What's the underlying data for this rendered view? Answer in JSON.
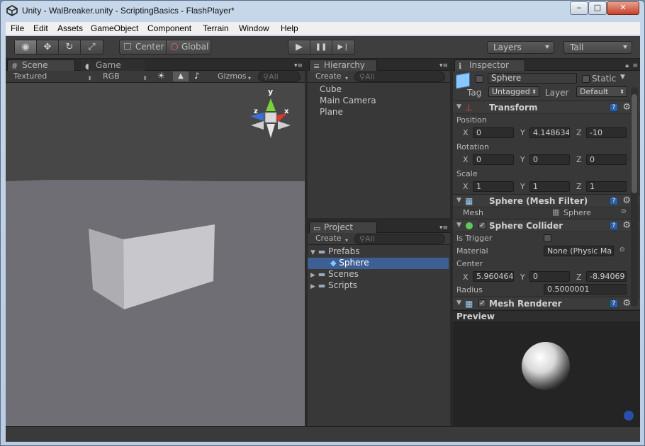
{
  "window": {
    "title": "Unity - WalBreaker.unity - ScriptingBasics - FlashPlayer*",
    "controls": {
      "minimize": "‒",
      "maximize": "□",
      "close": "✕"
    }
  },
  "menu": [
    "File",
    "Edit",
    "Assets",
    "GameObject",
    "Component",
    "Terrain",
    "Window",
    "Help"
  ],
  "toolbar": {
    "tools": [
      {
        "icon": "eye-icon",
        "glyph": "◉",
        "active": true
      },
      {
        "icon": "move-icon",
        "glyph": "✥",
        "active": false
      },
      {
        "icon": "rotate-icon",
        "glyph": "↻",
        "active": false
      },
      {
        "icon": "scale-icon",
        "glyph": "⤢",
        "active": false
      }
    ],
    "pivot_label": "Center",
    "space_label": "Global",
    "play_glyph": "▶",
    "pause_glyph": "❚❚",
    "step_glyph": "▶❘",
    "layers_label": "Layers",
    "layout_label": "Tall"
  },
  "scene": {
    "tabs": [
      {
        "label": "Scene",
        "icon": "scene-grid-icon",
        "glyph": "#"
      },
      {
        "label": "Game",
        "icon": "game-pacman-icon",
        "glyph": "◖"
      }
    ],
    "render_mode": "Textured",
    "color_mode": "RGB",
    "gizmos_label": "Gizmos",
    "search_placeholder": "All",
    "gizmo_y_label": "y",
    "gizmo_z_label": "z",
    "gizmo_x_label": "x",
    "colors": {
      "sky": "#474747",
      "ground": "#6e6e74",
      "cube_side": "#aeaeb2",
      "cube_front": "#c8c8cc"
    }
  },
  "hierarchy": {
    "tab": "Hierarchy",
    "create_label": "Create",
    "search_placeholder": "All",
    "items": [
      "Cube",
      "Main Camera",
      "Plane"
    ]
  },
  "project": {
    "tab": "Project",
    "create_label": "Create",
    "search_placeholder": "All",
    "folders": [
      {
        "label": "Prefabs",
        "expanded": true,
        "children": [
          {
            "label": "Sphere",
            "selected": true
          }
        ]
      },
      {
        "label": "Scenes",
        "expanded": false
      },
      {
        "label": "Scripts",
        "expanded": false
      }
    ]
  },
  "inspector": {
    "tab": "Inspector",
    "object_name": "Sphere",
    "static_label": "Static",
    "tag_label": "Tag",
    "tag_value": "Untagged",
    "layer_label": "Layer",
    "layer_value": "Default",
    "transform": {
      "title": "Transform",
      "position_label": "Position",
      "rotation_label": "Rotation",
      "scale_label": "Scale",
      "position": {
        "x": "0",
        "y": "4.148634",
        "z": "-10"
      },
      "rotation": {
        "x": "0",
        "y": "0",
        "z": "0"
      },
      "scale": {
        "x": "1",
        "y": "1",
        "z": "1"
      }
    },
    "mesh_filter": {
      "title": "Sphere (Mesh Filter)",
      "mesh_label": "Mesh",
      "mesh_value": "Sphere"
    },
    "sphere_collider": {
      "title": "Sphere Collider",
      "is_trigger_label": "Is Trigger",
      "material_label": "Material",
      "material_value": "None (Physic Ma",
      "center_label": "Center",
      "center": {
        "x": "5.960464",
        "y": "0",
        "z": "-8.94069"
      },
      "radius_label": "Radius",
      "radius_value": "0.5000001"
    },
    "mesh_renderer": {
      "title": "Mesh Renderer"
    },
    "preview_label": "Preview"
  }
}
